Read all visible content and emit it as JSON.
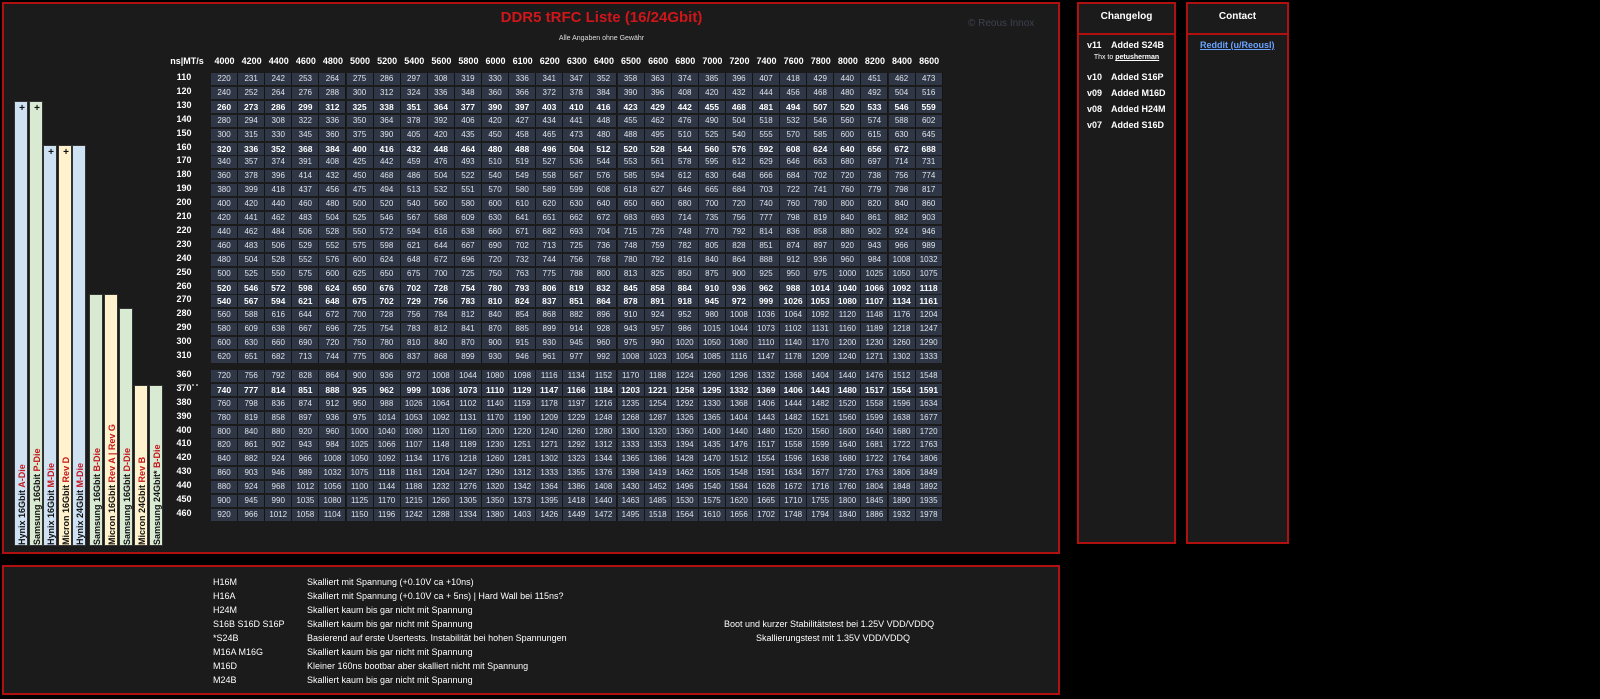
{
  "title": "DDR5 tRFC Liste (16/24Gbit)",
  "subtitle": "Alle Angaben ohne Gewähr",
  "watermark": "© Reous Innox",
  "corner_header": "ns|MT/s",
  "speeds": [
    "4000",
    "4200",
    "4400",
    "4600",
    "4800",
    "5000",
    "5200",
    "5400",
    "5600",
    "5800",
    "6000",
    "6100",
    "6200",
    "6300",
    "6400",
    "6500",
    "6600",
    "6800",
    "7000",
    "7200",
    "7400",
    "7600",
    "7800",
    "8000",
    "8200",
    "8400",
    "8600"
  ],
  "rows": [
    {
      "ns": "110",
      "bold": false,
      "values": [
        "220",
        "231",
        "242",
        "253",
        "264",
        "275",
        "286",
        "297",
        "308",
        "319",
        "330",
        "336",
        "341",
        "347",
        "352",
        "358",
        "363",
        "374",
        "385",
        "396",
        "407",
        "418",
        "429",
        "440",
        "451",
        "462",
        "473"
      ]
    },
    {
      "ns": "120",
      "bold": false,
      "values": [
        "240",
        "252",
        "264",
        "276",
        "288",
        "300",
        "312",
        "324",
        "336",
        "348",
        "360",
        "366",
        "372",
        "378",
        "384",
        "390",
        "396",
        "408",
        "420",
        "432",
        "444",
        "456",
        "468",
        "480",
        "492",
        "504",
        "516"
      ]
    },
    {
      "ns": "130",
      "bold": true,
      "values": [
        "260",
        "273",
        "286",
        "299",
        "312",
        "325",
        "338",
        "351",
        "364",
        "377",
        "390",
        "397",
        "403",
        "410",
        "416",
        "423",
        "429",
        "442",
        "455",
        "468",
        "481",
        "494",
        "507",
        "520",
        "533",
        "546",
        "559"
      ]
    },
    {
      "ns": "140",
      "bold": false,
      "values": [
        "280",
        "294",
        "308",
        "322",
        "336",
        "350",
        "364",
        "378",
        "392",
        "406",
        "420",
        "427",
        "434",
        "441",
        "448",
        "455",
        "462",
        "476",
        "490",
        "504",
        "518",
        "532",
        "546",
        "560",
        "574",
        "588",
        "602"
      ]
    },
    {
      "ns": "150",
      "bold": false,
      "values": [
        "300",
        "315",
        "330",
        "345",
        "360",
        "375",
        "390",
        "405",
        "420",
        "435",
        "450",
        "458",
        "465",
        "473",
        "480",
        "488",
        "495",
        "510",
        "525",
        "540",
        "555",
        "570",
        "585",
        "600",
        "615",
        "630",
        "645"
      ]
    },
    {
      "ns": "160",
      "bold": true,
      "values": [
        "320",
        "336",
        "352",
        "368",
        "384",
        "400",
        "416",
        "432",
        "448",
        "464",
        "480",
        "488",
        "496",
        "504",
        "512",
        "520",
        "528",
        "544",
        "560",
        "576",
        "592",
        "608",
        "624",
        "640",
        "656",
        "672",
        "688"
      ]
    },
    {
      "ns": "170",
      "bold": false,
      "values": [
        "340",
        "357",
        "374",
        "391",
        "408",
        "425",
        "442",
        "459",
        "476",
        "493",
        "510",
        "519",
        "527",
        "536",
        "544",
        "553",
        "561",
        "578",
        "595",
        "612",
        "629",
        "646",
        "663",
        "680",
        "697",
        "714",
        "731"
      ]
    },
    {
      "ns": "180",
      "bold": false,
      "values": [
        "360",
        "378",
        "396",
        "414",
        "432",
        "450",
        "468",
        "486",
        "504",
        "522",
        "540",
        "549",
        "558",
        "567",
        "576",
        "585",
        "594",
        "612",
        "630",
        "648",
        "666",
        "684",
        "702",
        "720",
        "738",
        "756",
        "774"
      ]
    },
    {
      "ns": "190",
      "bold": false,
      "values": [
        "380",
        "399",
        "418",
        "437",
        "456",
        "475",
        "494",
        "513",
        "532",
        "551",
        "570",
        "580",
        "589",
        "599",
        "608",
        "618",
        "627",
        "646",
        "665",
        "684",
        "703",
        "722",
        "741",
        "760",
        "779",
        "798",
        "817"
      ]
    },
    {
      "ns": "200",
      "bold": false,
      "values": [
        "400",
        "420",
        "440",
        "460",
        "480",
        "500",
        "520",
        "540",
        "560",
        "580",
        "600",
        "610",
        "620",
        "630",
        "640",
        "650",
        "660",
        "680",
        "700",
        "720",
        "740",
        "760",
        "780",
        "800",
        "820",
        "840",
        "860"
      ]
    },
    {
      "ns": "210",
      "bold": false,
      "values": [
        "420",
        "441",
        "462",
        "483",
        "504",
        "525",
        "546",
        "567",
        "588",
        "609",
        "630",
        "641",
        "651",
        "662",
        "672",
        "683",
        "693",
        "714",
        "735",
        "756",
        "777",
        "798",
        "819",
        "840",
        "861",
        "882",
        "903"
      ]
    },
    {
      "ns": "220",
      "bold": false,
      "values": [
        "440",
        "462",
        "484",
        "506",
        "528",
        "550",
        "572",
        "594",
        "616",
        "638",
        "660",
        "671",
        "682",
        "693",
        "704",
        "715",
        "726",
        "748",
        "770",
        "792",
        "814",
        "836",
        "858",
        "880",
        "902",
        "924",
        "946"
      ]
    },
    {
      "ns": "230",
      "bold": false,
      "values": [
        "460",
        "483",
        "506",
        "529",
        "552",
        "575",
        "598",
        "621",
        "644",
        "667",
        "690",
        "702",
        "713",
        "725",
        "736",
        "748",
        "759",
        "782",
        "805",
        "828",
        "851",
        "874",
        "897",
        "920",
        "943",
        "966",
        "989"
      ]
    },
    {
      "ns": "240",
      "bold": false,
      "values": [
        "480",
        "504",
        "528",
        "552",
        "576",
        "600",
        "624",
        "648",
        "672",
        "696",
        "720",
        "732",
        "744",
        "756",
        "768",
        "780",
        "792",
        "816",
        "840",
        "864",
        "888",
        "912",
        "936",
        "960",
        "984",
        "1008",
        "1032"
      ]
    },
    {
      "ns": "250",
      "bold": false,
      "values": [
        "500",
        "525",
        "550",
        "575",
        "600",
        "625",
        "650",
        "675",
        "700",
        "725",
        "750",
        "763",
        "775",
        "788",
        "800",
        "813",
        "825",
        "850",
        "875",
        "900",
        "925",
        "950",
        "975",
        "1000",
        "1025",
        "1050",
        "1075"
      ]
    },
    {
      "ns": "260",
      "bold": true,
      "values": [
        "520",
        "546",
        "572",
        "598",
        "624",
        "650",
        "676",
        "702",
        "728",
        "754",
        "780",
        "793",
        "806",
        "819",
        "832",
        "845",
        "858",
        "884",
        "910",
        "936",
        "962",
        "988",
        "1014",
        "1040",
        "1066",
        "1092",
        "1118"
      ]
    },
    {
      "ns": "270",
      "bold": true,
      "values": [
        "540",
        "567",
        "594",
        "621",
        "648",
        "675",
        "702",
        "729",
        "756",
        "783",
        "810",
        "824",
        "837",
        "851",
        "864",
        "878",
        "891",
        "918",
        "945",
        "972",
        "999",
        "1026",
        "1053",
        "1080",
        "1107",
        "1134",
        "1161"
      ]
    },
    {
      "ns": "280",
      "bold": false,
      "values": [
        "560",
        "588",
        "616",
        "644",
        "672",
        "700",
        "728",
        "756",
        "784",
        "812",
        "840",
        "854",
        "868",
        "882",
        "896",
        "910",
        "924",
        "952",
        "980",
        "1008",
        "1036",
        "1064",
        "1092",
        "1120",
        "1148",
        "1176",
        "1204"
      ]
    },
    {
      "ns": "290",
      "bold": false,
      "values": [
        "580",
        "609",
        "638",
        "667",
        "696",
        "725",
        "754",
        "783",
        "812",
        "841",
        "870",
        "885",
        "899",
        "914",
        "928",
        "943",
        "957",
        "986",
        "1015",
        "1044",
        "1073",
        "1102",
        "1131",
        "1160",
        "1189",
        "1218",
        "1247"
      ]
    },
    {
      "ns": "300",
      "bold": false,
      "values": [
        "600",
        "630",
        "660",
        "690",
        "720",
        "750",
        "780",
        "810",
        "840",
        "870",
        "900",
        "915",
        "930",
        "945",
        "960",
        "975",
        "990",
        "1020",
        "1050",
        "1080",
        "1110",
        "1140",
        "1170",
        "1200",
        "1230",
        "1260",
        "1290"
      ]
    },
    {
      "ns": "310",
      "bold": false,
      "values": [
        "620",
        "651",
        "682",
        "713",
        "744",
        "775",
        "806",
        "837",
        "868",
        "899",
        "930",
        "946",
        "961",
        "977",
        "992",
        "1008",
        "1023",
        "1054",
        "1085",
        "1116",
        "1147",
        "1178",
        "1209",
        "1240",
        "1271",
        "1302",
        "1333"
      ]
    },
    {
      "ns": "360",
      "bold": false,
      "values": [
        "720",
        "756",
        "792",
        "828",
        "864",
        "900",
        "936",
        "972",
        "1008",
        "1044",
        "1080",
        "1098",
        "1116",
        "1134",
        "1152",
        "1170",
        "1188",
        "1224",
        "1260",
        "1296",
        "1332",
        "1368",
        "1404",
        "1440",
        "1476",
        "1512",
        "1548"
      ]
    },
    {
      "ns": "370",
      "bold": true,
      "values": [
        "740",
        "777",
        "814",
        "851",
        "888",
        "925",
        "962",
        "999",
        "1036",
        "1073",
        "1110",
        "1129",
        "1147",
        "1166",
        "1184",
        "1203",
        "1221",
        "1258",
        "1295",
        "1332",
        "1369",
        "1406",
        "1443",
        "1480",
        "1517",
        "1554",
        "1591"
      ]
    },
    {
      "ns": "380",
      "bold": false,
      "values": [
        "760",
        "798",
        "836",
        "874",
        "912",
        "950",
        "988",
        "1026",
        "1064",
        "1102",
        "1140",
        "1159",
        "1178",
        "1197",
        "1216",
        "1235",
        "1254",
        "1292",
        "1330",
        "1368",
        "1406",
        "1444",
        "1482",
        "1520",
        "1558",
        "1596",
        "1634"
      ]
    },
    {
      "ns": "390",
      "bold": false,
      "values": [
        "780",
        "819",
        "858",
        "897",
        "936",
        "975",
        "1014",
        "1053",
        "1092",
        "1131",
        "1170",
        "1190",
        "1209",
        "1229",
        "1248",
        "1268",
        "1287",
        "1326",
        "1365",
        "1404",
        "1443",
        "1482",
        "1521",
        "1560",
        "1599",
        "1638",
        "1677"
      ]
    },
    {
      "ns": "400",
      "bold": false,
      "values": [
        "800",
        "840",
        "880",
        "920",
        "960",
        "1000",
        "1040",
        "1080",
        "1120",
        "1160",
        "1200",
        "1220",
        "1240",
        "1260",
        "1280",
        "1300",
        "1320",
        "1360",
        "1400",
        "1440",
        "1480",
        "1520",
        "1560",
        "1600",
        "1640",
        "1680",
        "1720"
      ]
    },
    {
      "ns": "410",
      "bold": false,
      "values": [
        "820",
        "861",
        "902",
        "943",
        "984",
        "1025",
        "1066",
        "1107",
        "1148",
        "1189",
        "1230",
        "1251",
        "1271",
        "1292",
        "1312",
        "1333",
        "1353",
        "1394",
        "1435",
        "1476",
        "1517",
        "1558",
        "1599",
        "1640",
        "1681",
        "1722",
        "1763"
      ]
    },
    {
      "ns": "420",
      "bold": false,
      "values": [
        "840",
        "882",
        "924",
        "966",
        "1008",
        "1050",
        "1092",
        "1134",
        "1176",
        "1218",
        "1260",
        "1281",
        "1302",
        "1323",
        "1344",
        "1365",
        "1386",
        "1428",
        "1470",
        "1512",
        "1554",
        "1596",
        "1638",
        "1680",
        "1722",
        "1764",
        "1806"
      ]
    },
    {
      "ns": "430",
      "bold": false,
      "values": [
        "860",
        "903",
        "946",
        "989",
        "1032",
        "1075",
        "1118",
        "1161",
        "1204",
        "1247",
        "1290",
        "1312",
        "1333",
        "1355",
        "1376",
        "1398",
        "1419",
        "1462",
        "1505",
        "1548",
        "1591",
        "1634",
        "1677",
        "1720",
        "1763",
        "1806",
        "1849"
      ]
    },
    {
      "ns": "440",
      "bold": false,
      "values": [
        "880",
        "924",
        "968",
        "1012",
        "1056",
        "1100",
        "1144",
        "1188",
        "1232",
        "1276",
        "1320",
        "1342",
        "1364",
        "1386",
        "1408",
        "1430",
        "1452",
        "1496",
        "1540",
        "1584",
        "1628",
        "1672",
        "1716",
        "1760",
        "1804",
        "1848",
        "1892"
      ]
    },
    {
      "ns": "450",
      "bold": false,
      "values": [
        "900",
        "945",
        "990",
        "1035",
        "1080",
        "1125",
        "1170",
        "1215",
        "1260",
        "1305",
        "1350",
        "1373",
        "1395",
        "1418",
        "1440",
        "1463",
        "1485",
        "1530",
        "1575",
        "1620",
        "1665",
        "1710",
        "1755",
        "1800",
        "1845",
        "1890",
        "1935"
      ]
    },
    {
      "ns": "460",
      "bold": false,
      "values": [
        "920",
        "966",
        "1012",
        "1058",
        "1104",
        "1150",
        "1196",
        "1242",
        "1288",
        "1334",
        "1380",
        "1403",
        "1426",
        "1449",
        "1472",
        "1495",
        "1518",
        "1564",
        "1610",
        "1656",
        "1702",
        "1748",
        "1794",
        "1840",
        "1886",
        "1932",
        "1978"
      ]
    }
  ],
  "die_columns": [
    {
      "mfr": "Hynix",
      "cap": "16Gbit",
      "die": "A-Die",
      "color": "#cfe2f3",
      "plus": "+"
    },
    {
      "mfr": "Samsung",
      "cap": "16Gbit",
      "die": "P-Die",
      "color": "#d9ead3",
      "plus": "+"
    },
    {
      "mfr": "Hynix",
      "cap": "16Gbit",
      "die": "M-Die",
      "color": "#cfe2f3",
      "plus": "+"
    },
    {
      "mfr": "Micron",
      "cap": "16Gbit",
      "die": "Rev D",
      "color": "#fff2cc",
      "plus": "+"
    },
    {
      "mfr": "Hynix",
      "cap": "24Gbit",
      "die": "M-Die",
      "color": "#cfe2f3",
      "plus": ""
    },
    {
      "mfr": "Samsung",
      "cap": "16Gbit",
      "die": "B-Die",
      "color": "#d9ead3",
      "plus": ""
    },
    {
      "mfr": "Micron",
      "cap": "16Gbit",
      "die": "Rev A | Rev G",
      "color": "#fff2cc",
      "plus": ""
    },
    {
      "mfr": "Samsung",
      "cap": "16Gbit",
      "die": "D-Die",
      "color": "#d9ead3",
      "plus": ""
    },
    {
      "mfr": "Micron",
      "cap": "24Gbit",
      "die": "Rev B",
      "color": "#fff2cc",
      "plus": ""
    },
    {
      "mfr": "Samsung",
      "cap": "24Gbit*",
      "die": "B-Die",
      "color": "#d9ead3",
      "plus": ""
    }
  ],
  "changelog": {
    "title": "Changelog",
    "items": [
      {
        "ver": "v11",
        "text": "Added S24B"
      },
      {
        "ver": "v10",
        "text": "Added S16P"
      },
      {
        "ver": "v09",
        "text": "Added M16D"
      },
      {
        "ver": "v08",
        "text": "Added H24M"
      },
      {
        "ver": "v07",
        "text": "Added S16D"
      }
    ],
    "thanks_prefix": "Thx to ",
    "thanks_name": "petusherman"
  },
  "contact": {
    "title": "Contact",
    "link": "Reddit (u/ReousI)"
  },
  "notes": [
    {
      "key": "H16M",
      "val": "Skalliert mit Spannung (+0.10V ca +10ns)"
    },
    {
      "key": "H16A",
      "val": "Skalliert mit Spannung (+0.10V ca + 5ns) | Hard Wall bei 115ns?"
    },
    {
      "key": "H24M",
      "val": "Skalliert kaum bis gar nicht mit Spannung"
    },
    {
      "key": "S16B    S16D    S16P",
      "val": "Skalliert kaum bis gar nicht mit Spannung"
    },
    {
      "key": "*S24B",
      "val": "Basierend auf erste Usertests. Instabilität bei hohen Spannungen"
    },
    {
      "key": "M16A   M16G",
      "val": "Skalliert kaum bis gar nicht mit Spannung"
    },
    {
      "key": "M16D",
      "val": "Kleiner 160ns bootbar aber skalliert nicht mit Spannung"
    },
    {
      "key": "M24B",
      "val": "Skalliert kaum bis gar nicht mit Spannung"
    }
  ],
  "notes_side": [
    "Boot und kurzer Stabilitätstest bei 1.25V VDD/VDDQ",
    "Skallierungstest mit 1.35V VDD/VDDQ"
  ]
}
